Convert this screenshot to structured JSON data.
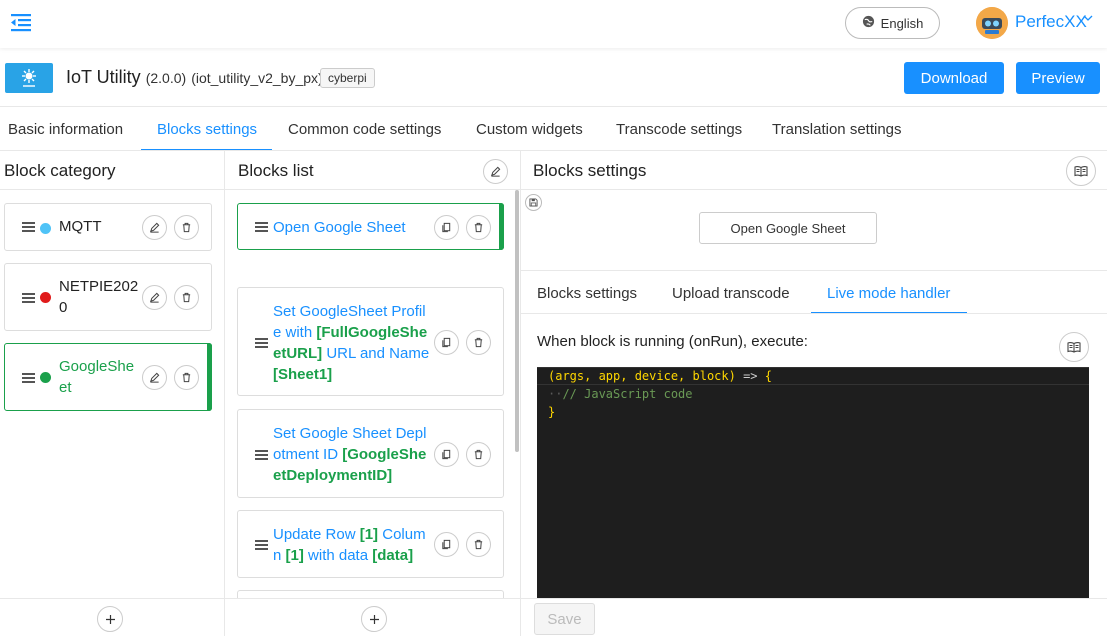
{
  "topbar": {
    "language_label": "English",
    "user_name": "PerfecXX"
  },
  "extension": {
    "name": "IoT Utility",
    "version": "(2.0.0)",
    "id": "(iot_utility_v2_by_px)",
    "tag": "cyberpi",
    "download_label": "Download",
    "preview_label": "Preview"
  },
  "main_tabs": [
    {
      "label": "Basic information"
    },
    {
      "label": "Blocks settings"
    },
    {
      "label": "Common code settings"
    },
    {
      "label": "Custom widgets"
    },
    {
      "label": "Transcode settings"
    },
    {
      "label": "Translation settings"
    }
  ],
  "category_panel": {
    "title": "Block category",
    "items": [
      {
        "label_line1": "MQTT",
        "label_line2": "",
        "color": "#4fc3f7"
      },
      {
        "label_line1": "NETPIE202",
        "label_line2": "0",
        "color": "#e01b1b"
      },
      {
        "label_line1": "GoogleShe",
        "label_line2": "et",
        "color": "#1aa04b"
      }
    ]
  },
  "blocks_panel": {
    "title": "Blocks list",
    "blocks": [
      {
        "lines": [
          [
            "Open Google Sheet",
            ""
          ]
        ]
      },
      {
        "lines": [
          [
            "Set GoogleSheet Profil",
            ""
          ],
          [
            "e with ",
            "[FullGoogleShe"
          ],
          [
            "",
            "etURL]"
          ],
          [
            " URL and Name",
            ""
          ],
          [
            "",
            "[Sheet1]"
          ]
        ]
      },
      {
        "lines": [
          [
            "Set Google Sheet Depl",
            ""
          ],
          [
            "otment ID ",
            "[GoogleShe"
          ],
          [
            "",
            "etDeploymentID]"
          ]
        ]
      },
      {
        "lines": [
          [
            "Update Row ",
            "[1]"
          ],
          [
            " Colum",
            ""
          ],
          [
            "n ",
            "[1]"
          ],
          [
            " with data ",
            "[data]"
          ]
        ]
      }
    ]
  },
  "settings_panel": {
    "title": "Blocks settings",
    "block_preview_label": "Open Google Sheet",
    "sub_tabs": [
      {
        "label": "Blocks settings"
      },
      {
        "label": "Upload transcode"
      },
      {
        "label": "Live mode handler"
      }
    ],
    "exec_label": "When block is running (onRun), execute:",
    "code_line1_params": "(args, app, device, block)",
    "code_line1_arrow": " => ",
    "code_line1_brace": "{",
    "code_line2": "// JavaScript code",
    "code_line3": "}",
    "save_label": "Save"
  },
  "colors": {
    "accent": "#1890ff",
    "active_green": "#1aa04b"
  }
}
